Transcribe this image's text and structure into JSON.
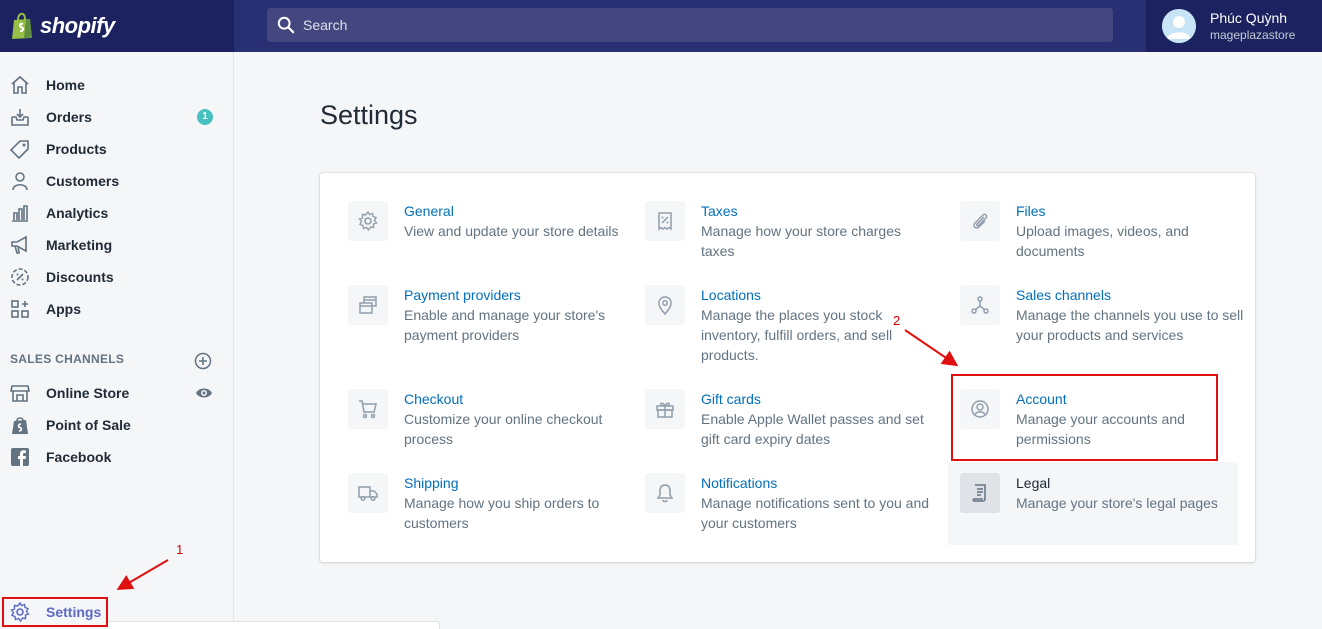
{
  "brand": {
    "name": "shopify"
  },
  "search": {
    "placeholder": "Search"
  },
  "user": {
    "name": "Phúc Quỳnh",
    "store": "mageplazastore"
  },
  "sidebar": {
    "items": [
      {
        "label": "Home",
        "icon": "home-icon"
      },
      {
        "label": "Orders",
        "icon": "orders-icon",
        "badge": "1"
      },
      {
        "label": "Products",
        "icon": "tag-icon"
      },
      {
        "label": "Customers",
        "icon": "person-icon"
      },
      {
        "label": "Analytics",
        "icon": "bar-chart-icon"
      },
      {
        "label": "Marketing",
        "icon": "megaphone-icon"
      },
      {
        "label": "Discounts",
        "icon": "discount-icon"
      },
      {
        "label": "Apps",
        "icon": "apps-icon"
      }
    ],
    "sales_channels_title": "SALES CHANNELS",
    "channels": [
      {
        "label": "Online Store",
        "icon": "store-icon"
      },
      {
        "label": "Point of Sale",
        "icon": "pos-icon"
      },
      {
        "label": "Facebook",
        "icon": "facebook-icon"
      }
    ],
    "settings_label": "Settings"
  },
  "page": {
    "title": "Settings"
  },
  "settings": [
    {
      "title": "General",
      "desc": "View and update your store details",
      "icon": "gear-icon"
    },
    {
      "title": "Taxes",
      "desc": "Manage how your store charges taxes",
      "icon": "receipt-icon"
    },
    {
      "title": "Files",
      "desc": "Upload images, videos, and documents",
      "icon": "paperclip-icon"
    },
    {
      "title": "Payment providers",
      "desc": "Enable and manage your store's payment providers",
      "icon": "payment-icon"
    },
    {
      "title": "Locations",
      "desc": "Manage the places you stock inventory, fulfill orders, and sell products.",
      "icon": "location-icon"
    },
    {
      "title": "Sales channels",
      "desc": "Manage the channels you use to sell your products and services",
      "icon": "channels-icon"
    },
    {
      "title": "Checkout",
      "desc": "Customize your online checkout process",
      "icon": "cart-icon"
    },
    {
      "title": "Gift cards",
      "desc": "Enable Apple Wallet passes and set gift card expiry dates",
      "icon": "gift-icon"
    },
    {
      "title": "Account",
      "desc": "Manage your accounts and permissions",
      "icon": "account-icon"
    },
    {
      "title": "Shipping",
      "desc": "Manage how you ship orders to customers",
      "icon": "truck-icon"
    },
    {
      "title": "Notifications",
      "desc": "Manage notifications sent to you and your customers",
      "icon": "bell-icon"
    },
    {
      "title": "Legal",
      "desc": "Manage your store's legal pages",
      "icon": "legal-icon"
    }
  ],
  "annotations": {
    "step1": "1",
    "step2": "2"
  },
  "colors": {
    "topbar": "#1c2260",
    "link": "#006fbb",
    "highlight": "#e01010",
    "badge": "#47c1bf"
  }
}
